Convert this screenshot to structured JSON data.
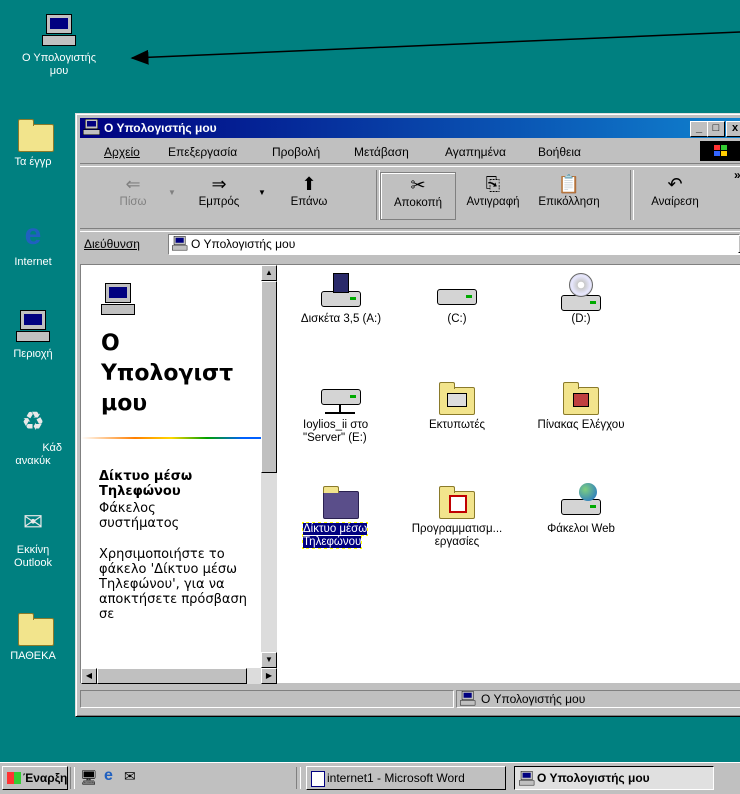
{
  "desktop": {
    "icons": [
      {
        "label_line1": "Ο Υπολογιστής",
        "label_line2": "μου"
      },
      {
        "label": "Τα έγγρ"
      },
      {
        "label": "Internet"
      },
      {
        "label": "Περιοχή"
      },
      {
        "label_line1": "Κάδ",
        "label_line2": "ανακύκ"
      },
      {
        "label_line1": "Εκκίνη",
        "label_line2": "Outlook"
      },
      {
        "label": "ΠΑΘΕΚΑ"
      }
    ]
  },
  "window": {
    "title": "Ο Υπολογιστής μου",
    "controls": {
      "minimize": "_",
      "maximize": "□",
      "close": "x"
    },
    "menu": [
      "Αρχείο",
      "Επεξεργασία",
      "Προβολή",
      "Μετάβαση",
      "Αγαπημένα",
      "Βοήθεια"
    ],
    "toolbar": [
      {
        "label": "Πίσω",
        "icon": "back-arrow-icon",
        "glyph": "⇐",
        "enabled": false
      },
      {
        "label": "Εμπρός",
        "icon": "forward-arrow-icon",
        "glyph": "⇒",
        "enabled": true
      },
      {
        "label": "Επάνω",
        "icon": "up-folder-icon",
        "glyph": "⬆",
        "enabled": true
      },
      {
        "label": "Αποκοπή",
        "icon": "scissors-icon",
        "glyph": "✂",
        "enabled": true
      },
      {
        "label": "Αντιγραφή",
        "icon": "copy-icon",
        "glyph": "⎘",
        "enabled": true
      },
      {
        "label": "Επικόλληση",
        "icon": "paste-icon",
        "glyph": "📋",
        "enabled": true
      },
      {
        "label": "Αναίρεση",
        "icon": "undo-icon",
        "glyph": "↶",
        "enabled": true
      }
    ],
    "toolbar_more": "»",
    "address": {
      "label": "Διεύθυνση",
      "value": "Ο Υπολογιστής μου"
    },
    "left_pane": {
      "title_line1": "Ο",
      "title_line2": "Υπολογιστ",
      "title_line3": "μου",
      "selection_title": "Δίκτυο μέσω Τηλεφώνου",
      "selection_type": "Φάκελος συστήματος",
      "description": "Χρησιμοποιήστε το φάκελο 'Δίκτυο μέσω Τηλεφώνου', για να αποκτήσετε πρόσβαση σε"
    },
    "items": [
      {
        "label": "Δισκέτα 3,5 (A:)",
        "icon": "floppy-drive-icon"
      },
      {
        "label": "(C:)",
        "icon": "hard-drive-icon"
      },
      {
        "label": "(D:)",
        "icon": "cd-drive-icon"
      },
      {
        "label": "Ioylios_ii στο \"Server\" (E:)",
        "icon": "network-drive-icon"
      },
      {
        "label": "Εκτυπωτές",
        "icon": "printers-folder-icon"
      },
      {
        "label": "Πίνακας Ελέγχου",
        "icon": "control-panel-icon"
      },
      {
        "label": "Δίκτυο μέσω Τηλεφώνου",
        "icon": "dialup-networking-icon",
        "selected": true
      },
      {
        "label": "Προγραμματισμ... εργασίες",
        "icon": "scheduled-tasks-icon"
      },
      {
        "label": "Φάκελοι Web",
        "icon": "web-folders-icon"
      }
    ],
    "status": "Ο Υπολογιστής μου"
  },
  "taskbar": {
    "start": "Έναρξη",
    "tasks": [
      {
        "label": "internet1 - Microsoft Word",
        "active": false
      },
      {
        "label": "Ο Υπολογιστής μου",
        "active": true
      }
    ]
  },
  "colors": {
    "desktop": "#008080",
    "title_active": "#000080",
    "face": "#c0c0c0",
    "selection": "#000080"
  }
}
